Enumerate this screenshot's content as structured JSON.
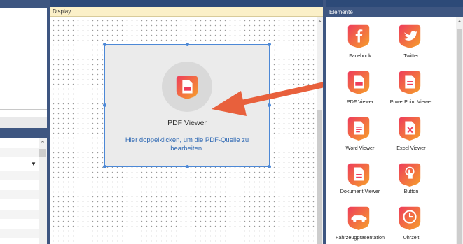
{
  "display": {
    "header": "Display",
    "widget_title": "PDF Viewer",
    "widget_hint": "Hier doppelklicken, um die PDF-Quelle zu bearbeiten."
  },
  "elements": {
    "header": "Elemente",
    "items": [
      {
        "label": "Facebook",
        "icon": "facebook-icon"
      },
      {
        "label": "Twitter",
        "icon": "twitter-icon"
      },
      {
        "label": "PDF Viewer",
        "icon": "pdf-icon"
      },
      {
        "label": "PowerPoint Viewer",
        "icon": "powerpoint-icon"
      },
      {
        "label": "Word Viewer",
        "icon": "word-icon"
      },
      {
        "label": "Excel Viewer",
        "icon": "excel-icon"
      },
      {
        "label": "Dokument Viewer",
        "icon": "document-icon"
      },
      {
        "label": "Button",
        "icon": "button-icon"
      },
      {
        "label": "Fahrzeugpräsentation",
        "icon": "car-icon"
      },
      {
        "label": "Uhrzeit",
        "icon": "clock-icon"
      }
    ]
  },
  "colors": {
    "accent_blue": "#3e5681",
    "selection_blue": "#4c88d6",
    "arrow": "#e8603c",
    "icon_gradient_start": "#ee3d5b",
    "icon_gradient_end": "#f6a12a"
  }
}
